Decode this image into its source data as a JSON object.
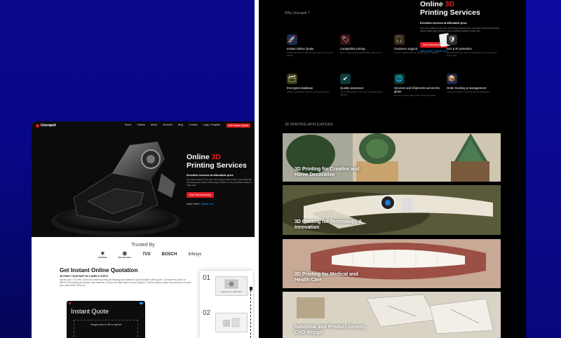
{
  "left": {
    "nav": {
      "logo": "Uoxrapid",
      "links": [
        "Home",
        "Gallery",
        "About",
        "Services",
        "Blog",
        "Contact",
        "Login | Register"
      ],
      "cta": "Get Instant Quote"
    },
    "hero": {
      "title_line1": "Online",
      "title_accent": "3D",
      "title_line2": "Printing Services",
      "subtitle": "Excellent services at affordable price",
      "description": "One stop solution for all your 3D printing requirements. Get Online 3D printing quotes, deliver within days. Deliver to any production facility in India, fast.",
      "cta": "Start Manufacturing",
      "upload_prefix": "Have Parts?",
      "upload_link": "Upload now"
    },
    "trusted": {
      "title": "Trusted By",
      "brands": [
        "iamFiltrate",
        "Mercedes-Benz",
        "TVS",
        "BOSCH",
        "Infosys"
      ]
    },
    "quote": {
      "title": "Get Instant Online Quotation",
      "subtitle": "3D PRINT YOUR PART IN 4 SIMPLE STEPS",
      "description": "Upload your .STL files. Select the desired printing technology and material to get an instant online quote. Compare the prices of different 3D printing techniques and materials. Choose the right match for your applica. Confirm delivery option and checkout, receive your parts within 48 hours.",
      "app_title": "Instant Quote",
      "app_drop": "Images drop in file to upload",
      "step1": "01",
      "step1_label": "Upload your CAD Files",
      "step2": "02"
    }
  },
  "right": {
    "why_label": "Why Uoxrapid ?",
    "title_line1": "Online",
    "title_accent": "3D",
    "title_line2": "Printing Services",
    "subtitle": "Excellent services at affordable price",
    "description": "One stop solution for all your 3D printing requirements. Get Online 3D printing quotes, deliver within days. Deliver to any production facility in India, fast.",
    "cta": "Start Manufacturing",
    "upload_prefix": "Have Parts?",
    "upload_link": "Upload now",
    "features": [
      {
        "title": "Instant Online Quote",
        "desc": "Upload cad files and get an instant quote for your 3D printing.",
        "icon": "rocket-icon"
      },
      {
        "title": "Competitive pricing",
        "desc": "Best in class pricing and affordable rates for you.",
        "icon": "price-tag-icon"
      },
      {
        "title": "Customer support",
        "desc": "Connect instantly with our support team for queries.",
        "icon": "headset-icon"
      },
      {
        "title": "ISO & IP protection",
        "desc": "We understand the value of IP and take every measure to keep it safe.",
        "icon": "shield-icon"
      },
      {
        "title": "Encrypted database",
        "desc": "All files uploaded are stored in encrypted servers.",
        "icon": "database-icon"
      },
      {
        "title": "Quality assurance",
        "desc": "The printed quality of your part is checked before dispatch.",
        "icon": "quality-icon"
      },
      {
        "title": "Services and shipments across the globe",
        "desc": "Get your product shipped from across the globe.",
        "icon": "globe-icon"
      },
      {
        "title": "Order tracking & management",
        "desc": "Track your orders in real time with our dashboard.",
        "icon": "tracking-icon"
      }
    ],
    "apps_title": "3D PRINTING APPLICATIONS",
    "applications": [
      {
        "label_line1": "3D Printing for Creative and",
        "label_line2": "Home Decorative"
      },
      {
        "label_line1": "3D Printing for Technology &",
        "label_line2": "Innovation"
      },
      {
        "label_line1": "3D Printing for Medical and",
        "label_line2": "Health Care"
      },
      {
        "label_line1": "Industrial and Product Design,",
        "label_line2": "CAD design"
      }
    ]
  },
  "colors": {
    "accent": "#e21b22",
    "background": "#08078a",
    "link": "#1e9bff"
  }
}
